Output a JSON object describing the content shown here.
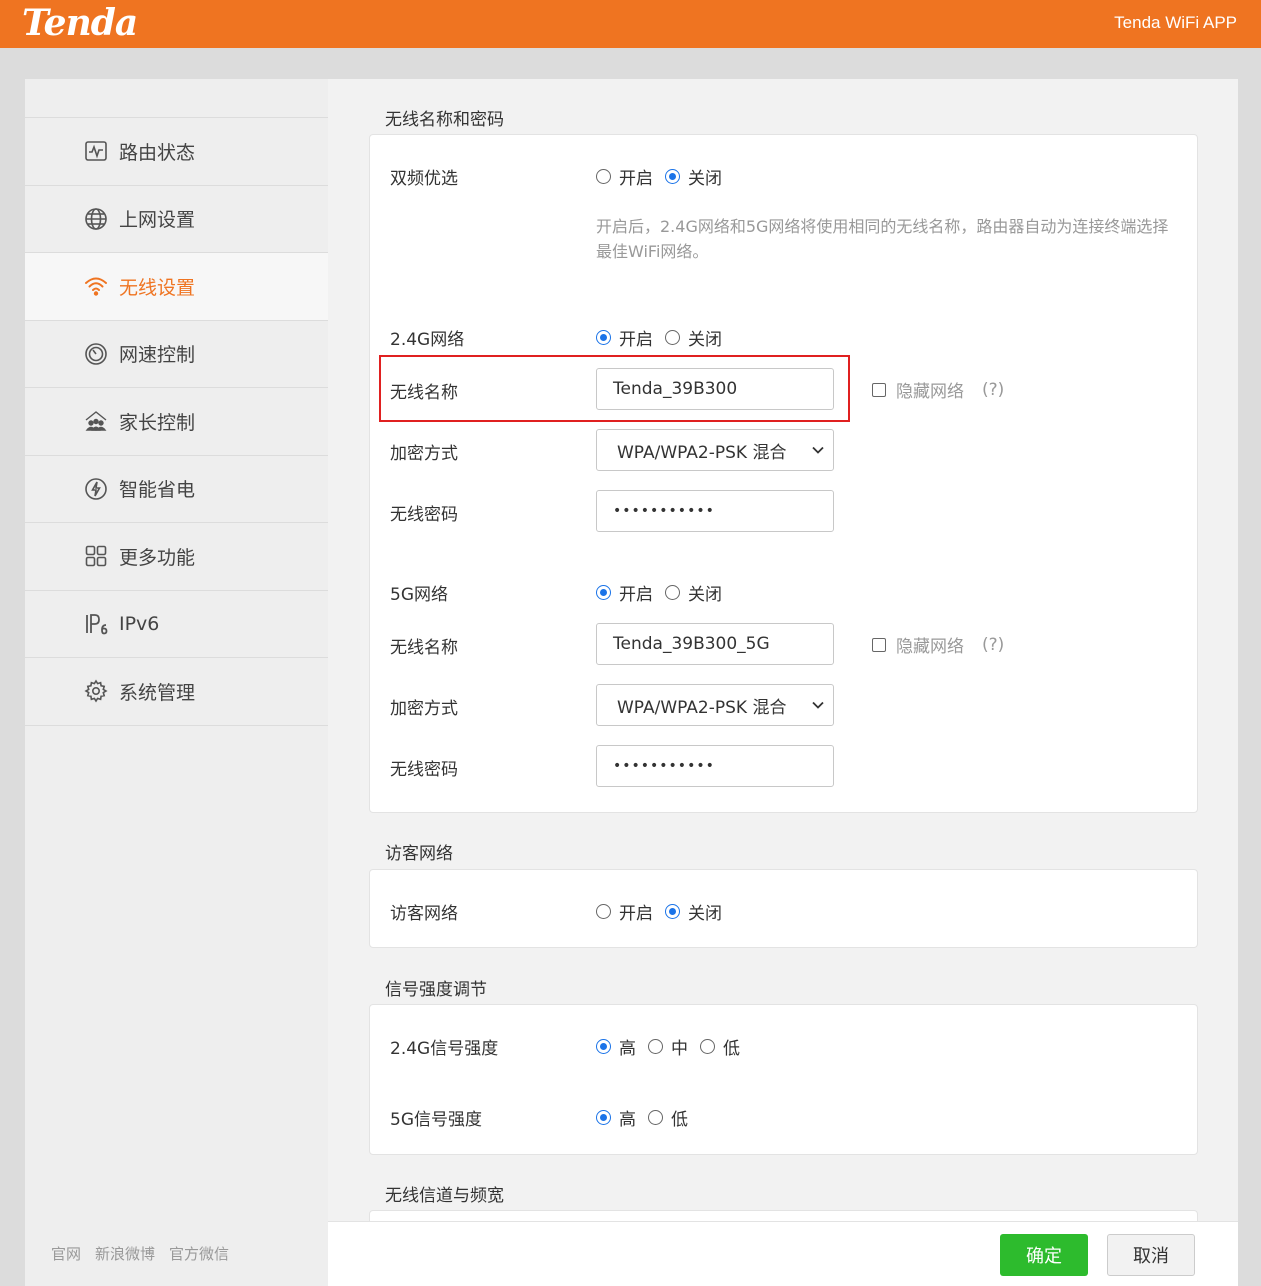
{
  "header": {
    "logo": "Tenda",
    "app_link": "Tenda WiFi APP"
  },
  "sidebar": {
    "items": [
      {
        "label": "路由状态",
        "icon": "monitor-pulse-icon"
      },
      {
        "label": "上网设置",
        "icon": "globe-icon"
      },
      {
        "label": "无线设置",
        "icon": "wifi-icon",
        "active": true
      },
      {
        "label": "网速控制",
        "icon": "speedometer-icon"
      },
      {
        "label": "家长控制",
        "icon": "family-icon"
      },
      {
        "label": "智能省电",
        "icon": "power-save-icon"
      },
      {
        "label": "更多功能",
        "icon": "grid-icon"
      },
      {
        "label": "IPv6",
        "icon": "ipv6-icon"
      },
      {
        "label": "系统管理",
        "icon": "gear-icon"
      }
    ],
    "footer": [
      "官网",
      "新浪微博",
      "官方微信"
    ]
  },
  "wireless": {
    "title": "无线名称和密码",
    "dual_band": {
      "label": "双频优选",
      "on": "开启",
      "off": "关闭",
      "selected": "off"
    },
    "hint": "开启后，2.4G网络和5G网络将使用相同的无线名称，路由器自动为连接终端选择最佳WiFi网络。",
    "band24": {
      "label": "2.4G网络",
      "on": "开启",
      "off": "关闭",
      "selected": "on",
      "ssid_label": "无线名称",
      "ssid": "Tenda_39B300",
      "hide_label": "隐藏网络",
      "help": "(?)",
      "security_label": "加密方式",
      "security": "WPA/WPA2-PSK 混合",
      "password_label": "无线密码",
      "password": "•••••••••••"
    },
    "band5": {
      "label": "5G网络",
      "on": "开启",
      "off": "关闭",
      "selected": "on",
      "ssid_label": "无线名称",
      "ssid": "Tenda_39B300_5G",
      "hide_label": "隐藏网络",
      "help": "(?)",
      "security_label": "加密方式",
      "security": "WPA/WPA2-PSK 混合",
      "password_label": "无线密码",
      "password": "•••••••••••"
    }
  },
  "guest": {
    "title": "访客网络",
    "label": "访客网络",
    "on": "开启",
    "off": "关闭",
    "selected": "off"
  },
  "signal": {
    "title": "信号强度调节",
    "band24": {
      "label": "2.4G信号强度",
      "high": "高",
      "mid": "中",
      "low": "低",
      "selected": "high"
    },
    "band5": {
      "label": "5G信号强度",
      "high": "高",
      "low": "低",
      "selected": "high"
    }
  },
  "channel": {
    "title": "无线信道与频宽"
  },
  "actions": {
    "ok": "确定",
    "cancel": "取消"
  },
  "colors": {
    "brand": "#ef7421",
    "ok": "#2dbb2d",
    "radio": "#1a73e8",
    "highlight": "#e02020"
  }
}
